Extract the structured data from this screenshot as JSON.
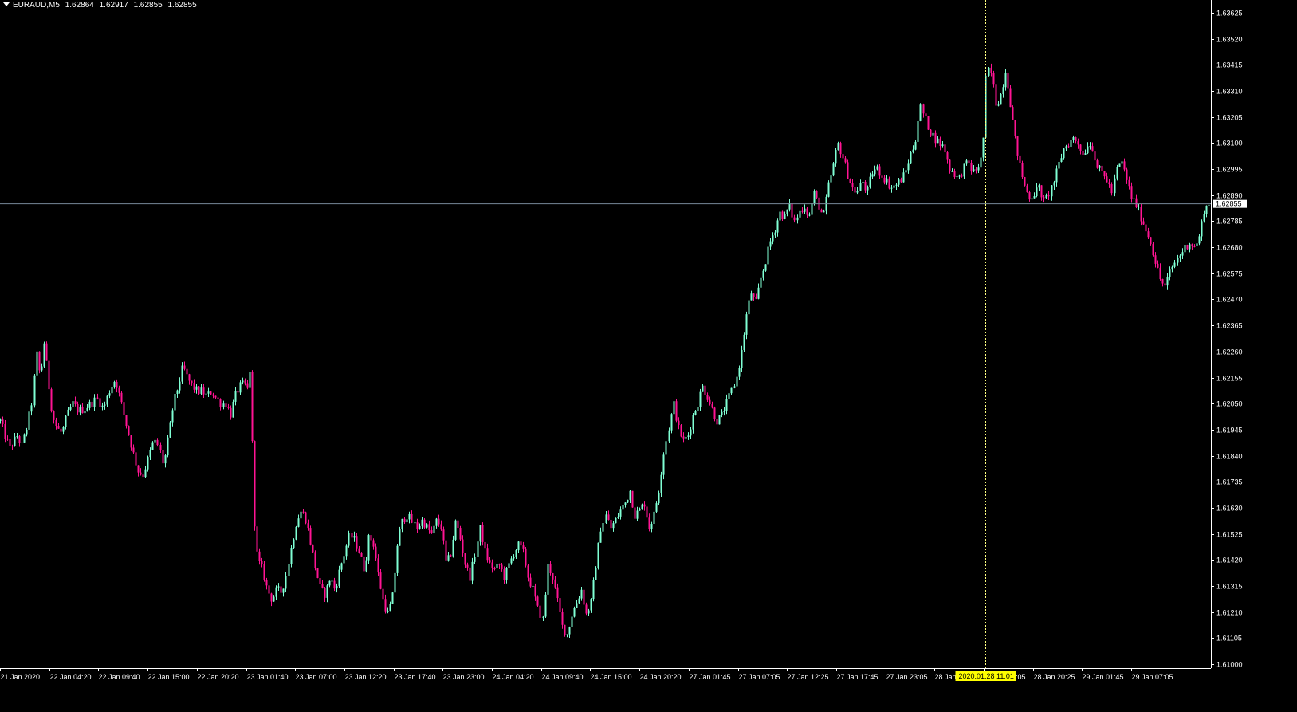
{
  "window": {
    "symbol": "EURAUD,M5",
    "ohlc": [
      "1.62864",
      "1.62917",
      "1.62855",
      "1.62855"
    ]
  },
  "colors": {
    "background": "#000000",
    "foreground": "#ffffff",
    "bull": "#7fffd4",
    "bear": "#ff1493",
    "bid_line": "#778899",
    "crosshair": "#ffff80",
    "current_price_label_bg": "#ffffff",
    "cursor_time_label_bg": "#ffff00"
  },
  "chart_data": {
    "type": "line",
    "style": "candlestick",
    "symbol": "EURAUD",
    "timeframe": "M5",
    "ylim": [
      1.61,
      1.63625
    ],
    "yticks": [
      "1.63625",
      "1.63520",
      "1.63415",
      "1.63310",
      "1.63205",
      "1.63100",
      "1.62995",
      "1.62890",
      "1.62785",
      "1.62680",
      "1.62575",
      "1.62470",
      "1.62365",
      "1.62260",
      "1.62155",
      "1.62050",
      "1.61945",
      "1.61840",
      "1.61735",
      "1.61630",
      "1.61525",
      "1.61420",
      "1.61315",
      "1.61210",
      "1.61105",
      "1.61000"
    ],
    "xticks": [
      "21 Jan 2020",
      "22 Jan 04:20",
      "22 Jan 09:40",
      "22 Jan 15:00",
      "22 Jan 20:20",
      "23 Jan 01:40",
      "23 Jan 07:00",
      "23 Jan 12:20",
      "23 Jan 17:40",
      "23 Jan 23:00",
      "24 Jan 04:20",
      "24 Jan 09:40",
      "24 Jan 15:00",
      "24 Jan 20:20",
      "27 Jan 01:45",
      "27 Jan 07:05",
      "27 Jan 12:25",
      "27 Jan 17:45",
      "27 Jan 23:05",
      "28 Jan 04",
      "28 Jan 15:05",
      "28 Jan 20:25",
      "29 Jan 01:45",
      "29 Jan 07:05"
    ],
    "current_price": 1.62855,
    "current_price_label": "1.62855",
    "cursor_time_label": "2020.01.28 11:01",
    "cursor_price": 1.6354,
    "cursor_bar_fraction": 0.8156,
    "grid": false,
    "series": [
      {
        "kind": "close_path",
        "values": [
          [
            0.0,
            1.6198
          ],
          [
            0.004,
            1.6192
          ],
          [
            0.008,
            1.6187
          ],
          [
            0.014,
            1.6192
          ],
          [
            0.018,
            1.6188
          ],
          [
            0.022,
            1.6195
          ],
          [
            0.026,
            1.6205
          ],
          [
            0.03,
            1.6225
          ],
          [
            0.033,
            1.6215
          ],
          [
            0.036,
            1.623
          ],
          [
            0.04,
            1.6212
          ],
          [
            0.043,
            1.62
          ],
          [
            0.047,
            1.6195
          ],
          [
            0.051,
            1.6193
          ],
          [
            0.055,
            1.62
          ],
          [
            0.06,
            1.6205
          ],
          [
            0.065,
            1.6202
          ],
          [
            0.07,
            1.6203
          ],
          [
            0.075,
            1.6205
          ],
          [
            0.08,
            1.6207
          ],
          [
            0.085,
            1.6203
          ],
          [
            0.09,
            1.621
          ],
          [
            0.095,
            1.6215
          ],
          [
            0.1,
            1.6205
          ],
          [
            0.105,
            1.6195
          ],
          [
            0.11,
            1.6185
          ],
          [
            0.114,
            1.6178
          ],
          [
            0.118,
            1.6176
          ],
          [
            0.122,
            1.6182
          ],
          [
            0.127,
            1.619
          ],
          [
            0.131,
            1.6188
          ],
          [
            0.135,
            1.618
          ],
          [
            0.139,
            1.6192
          ],
          [
            0.143,
            1.6205
          ],
          [
            0.147,
            1.6212
          ],
          [
            0.151,
            1.622
          ],
          [
            0.155,
            1.6215
          ],
          [
            0.159,
            1.6212
          ],
          [
            0.163,
            1.621
          ],
          [
            0.167,
            1.621
          ],
          [
            0.171,
            1.6208
          ],
          [
            0.175,
            1.621
          ],
          [
            0.179,
            1.6207
          ],
          [
            0.183,
            1.6205
          ],
          [
            0.187,
            1.6205
          ],
          [
            0.19,
            1.62
          ],
          [
            0.194,
            1.6208
          ],
          [
            0.198,
            1.6212
          ],
          [
            0.202,
            1.6213
          ],
          [
            0.205,
            1.621
          ],
          [
            0.207,
            1.6222
          ],
          [
            0.209,
            1.6175
          ],
          [
            0.211,
            1.615
          ],
          [
            0.213,
            1.6142
          ],
          [
            0.217,
            1.6138
          ],
          [
            0.221,
            1.613
          ],
          [
            0.225,
            1.6126
          ],
          [
            0.229,
            1.613
          ],
          [
            0.233,
            1.6129
          ],
          [
            0.237,
            1.6137
          ],
          [
            0.241,
            1.6148
          ],
          [
            0.245,
            1.6158
          ],
          [
            0.249,
            1.6162
          ],
          [
            0.253,
            1.6158
          ],
          [
            0.257,
            1.6148
          ],
          [
            0.261,
            1.6138
          ],
          [
            0.265,
            1.613
          ],
          [
            0.269,
            1.6128
          ],
          [
            0.273,
            1.6135
          ],
          [
            0.277,
            1.613
          ],
          [
            0.281,
            1.6138
          ],
          [
            0.285,
            1.6145
          ],
          [
            0.289,
            1.6152
          ],
          [
            0.293,
            1.615
          ],
          [
            0.297,
            1.6145
          ],
          [
            0.301,
            1.6138
          ],
          [
            0.305,
            1.6152
          ],
          [
            0.309,
            1.6148
          ],
          [
            0.313,
            1.6135
          ],
          [
            0.317,
            1.6125
          ],
          [
            0.321,
            1.612
          ],
          [
            0.325,
            1.6128
          ],
          [
            0.329,
            1.615
          ],
          [
            0.333,
            1.6158
          ],
          [
            0.337,
            1.616
          ],
          [
            0.341,
            1.6157
          ],
          [
            0.345,
            1.6155
          ],
          [
            0.349,
            1.6158
          ],
          [
            0.353,
            1.6155
          ],
          [
            0.357,
            1.6152
          ],
          [
            0.361,
            1.6158
          ],
          [
            0.365,
            1.6155
          ],
          [
            0.369,
            1.614
          ],
          [
            0.373,
            1.6145
          ],
          [
            0.377,
            1.6158
          ],
          [
            0.381,
            1.615
          ],
          [
            0.385,
            1.614
          ],
          [
            0.389,
            1.6135
          ],
          [
            0.393,
            1.6145
          ],
          [
            0.397,
            1.6155
          ],
          [
            0.401,
            1.6145
          ],
          [
            0.405,
            1.614
          ],
          [
            0.409,
            1.6138
          ],
          [
            0.413,
            1.614
          ],
          [
            0.417,
            1.6135
          ],
          [
            0.421,
            1.614
          ],
          [
            0.425,
            1.6145
          ],
          [
            0.429,
            1.6148
          ],
          [
            0.433,
            1.6145
          ],
          [
            0.437,
            1.6135
          ],
          [
            0.441,
            1.613
          ],
          [
            0.445,
            1.6122
          ],
          [
            0.449,
            1.6118
          ],
          [
            0.453,
            1.614
          ],
          [
            0.457,
            1.6135
          ],
          [
            0.461,
            1.6125
          ],
          [
            0.465,
            1.6115
          ],
          [
            0.469,
            1.6112
          ],
          [
            0.473,
            1.612
          ],
          [
            0.477,
            1.6125
          ],
          [
            0.481,
            1.613
          ],
          [
            0.485,
            1.612
          ],
          [
            0.489,
            1.6125
          ],
          [
            0.493,
            1.614
          ],
          [
            0.497,
            1.6155
          ],
          [
            0.501,
            1.616
          ],
          [
            0.505,
            1.6155
          ],
          [
            0.509,
            1.6158
          ],
          [
            0.513,
            1.6162
          ],
          [
            0.517,
            1.6165
          ],
          [
            0.521,
            1.617
          ],
          [
            0.525,
            1.616
          ],
          [
            0.529,
            1.6162
          ],
          [
            0.533,
            1.6165
          ],
          [
            0.537,
            1.6155
          ],
          [
            0.541,
            1.616
          ],
          [
            0.545,
            1.617
          ],
          [
            0.549,
            1.6185
          ],
          [
            0.553,
            1.6195
          ],
          [
            0.557,
            1.6205
          ],
          [
            0.561,
            1.6195
          ],
          [
            0.565,
            1.619
          ],
          [
            0.569,
            1.6192
          ],
          [
            0.573,
            1.62
          ],
          [
            0.577,
            1.6205
          ],
          [
            0.581,
            1.6212
          ],
          [
            0.585,
            1.6208
          ],
          [
            0.589,
            1.6203
          ],
          [
            0.593,
            1.6198
          ],
          [
            0.597,
            1.62
          ],
          [
            0.601,
            1.6205
          ],
          [
            0.605,
            1.621
          ],
          [
            0.609,
            1.6215
          ],
          [
            0.613,
            1.6225
          ],
          [
            0.617,
            1.624
          ],
          [
            0.621,
            1.625
          ],
          [
            0.625,
            1.6245
          ],
          [
            0.629,
            1.6255
          ],
          [
            0.633,
            1.6262
          ],
          [
            0.637,
            1.627
          ],
          [
            0.641,
            1.6275
          ],
          [
            0.645,
            1.6282
          ],
          [
            0.649,
            1.628
          ],
          [
            0.653,
            1.6285
          ],
          [
            0.657,
            1.6278
          ],
          [
            0.661,
            1.6282
          ],
          [
            0.665,
            1.6285
          ],
          [
            0.669,
            1.628
          ],
          [
            0.673,
            1.629
          ],
          [
            0.677,
            1.6285
          ],
          [
            0.681,
            1.628
          ],
          [
            0.685,
            1.6292
          ],
          [
            0.689,
            1.63
          ],
          [
            0.693,
            1.631
          ],
          [
            0.697,
            1.6305
          ],
          [
            0.701,
            1.6298
          ],
          [
            0.705,
            1.6292
          ],
          [
            0.709,
            1.629
          ],
          [
            0.713,
            1.6295
          ],
          [
            0.717,
            1.629
          ],
          [
            0.721,
            1.6298
          ],
          [
            0.725,
            1.63
          ],
          [
            0.729,
            1.6297
          ],
          [
            0.733,
            1.6295
          ],
          [
            0.737,
            1.6292
          ],
          [
            0.741,
            1.6293
          ],
          [
            0.745,
            1.6295
          ],
          [
            0.749,
            1.6298
          ],
          [
            0.753,
            1.6305
          ],
          [
            0.757,
            1.631
          ],
          [
            0.761,
            1.6325
          ],
          [
            0.765,
            1.632
          ],
          [
            0.769,
            1.6315
          ],
          [
            0.773,
            1.6312
          ],
          [
            0.777,
            1.631
          ],
          [
            0.781,
            1.6308
          ],
          [
            0.785,
            1.63
          ],
          [
            0.789,
            1.6298
          ],
          [
            0.793,
            1.6295
          ],
          [
            0.797,
            1.63
          ],
          [
            0.801,
            1.6302
          ],
          [
            0.805,
            1.6298
          ],
          [
            0.809,
            1.63
          ],
          [
            0.813,
            1.6305
          ],
          [
            0.816,
            1.634
          ],
          [
            0.82,
            1.6338
          ],
          [
            0.824,
            1.6325
          ],
          [
            0.828,
            1.633
          ],
          [
            0.832,
            1.634
          ],
          [
            0.836,
            1.6325
          ],
          [
            0.84,
            1.631
          ],
          [
            0.844,
            1.63
          ],
          [
            0.848,
            1.6292
          ],
          [
            0.852,
            1.6288
          ],
          [
            0.856,
            1.629
          ],
          [
            0.86,
            1.6292
          ],
          [
            0.864,
            1.6286
          ],
          [
            0.868,
            1.629
          ],
          [
            0.872,
            1.6295
          ],
          [
            0.876,
            1.6302
          ],
          [
            0.88,
            1.6308
          ],
          [
            0.884,
            1.631
          ],
          [
            0.888,
            1.6312
          ],
          [
            0.892,
            1.631
          ],
          [
            0.896,
            1.6305
          ],
          [
            0.9,
            1.631
          ],
          [
            0.904,
            1.6308
          ],
          [
            0.908,
            1.63
          ],
          [
            0.912,
            1.6298
          ],
          [
            0.916,
            1.6295
          ],
          [
            0.92,
            1.629
          ],
          [
            0.924,
            1.63
          ],
          [
            0.928,
            1.6302
          ],
          [
            0.932,
            1.6295
          ],
          [
            0.936,
            1.6288
          ],
          [
            0.94,
            1.6285
          ],
          [
            0.944,
            1.628
          ],
          [
            0.948,
            1.6275
          ],
          [
            0.952,
            1.627
          ],
          [
            0.956,
            1.6262
          ],
          [
            0.96,
            1.6255
          ],
          [
            0.964,
            1.6252
          ],
          [
            0.968,
            1.6258
          ],
          [
            0.972,
            1.6262
          ],
          [
            0.976,
            1.6265
          ],
          [
            0.98,
            1.6268
          ],
          [
            0.984,
            1.627
          ],
          [
            0.988,
            1.6268
          ],
          [
            0.992,
            1.6272
          ],
          [
            0.996,
            1.6283
          ],
          [
            1.0,
            1.62855
          ]
        ]
      }
    ]
  }
}
